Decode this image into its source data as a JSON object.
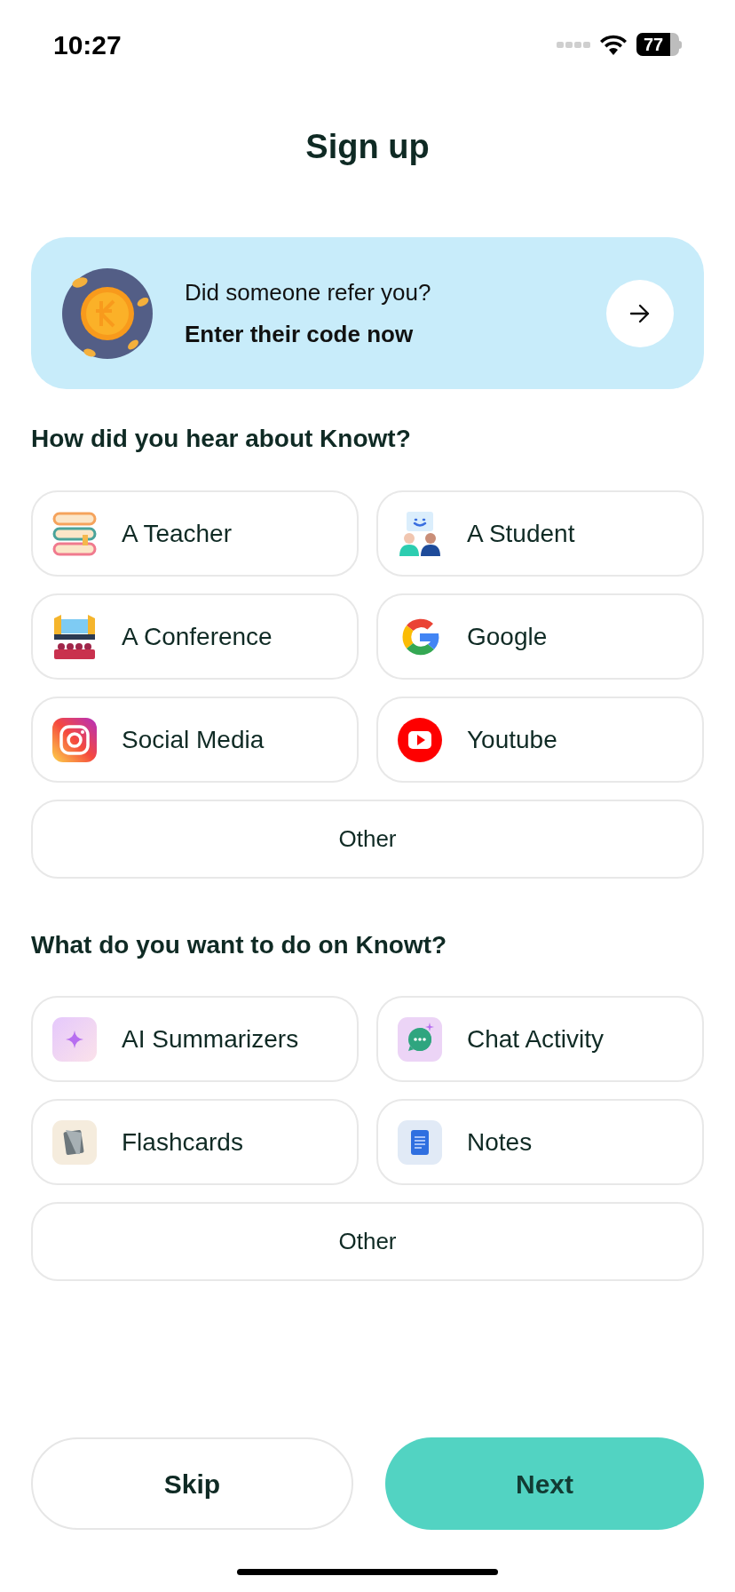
{
  "status_bar": {
    "time": "10:27",
    "battery": "77"
  },
  "title": "Sign up",
  "referral": {
    "question": "Did someone refer you?",
    "action": "Enter their code now"
  },
  "heard_about": {
    "heading": "How did you hear about Knowt?",
    "options": [
      {
        "label": "A Teacher",
        "kind": "teacher"
      },
      {
        "label": "A Student",
        "kind": "student"
      },
      {
        "label": "A Conference",
        "kind": "conference"
      },
      {
        "label": "Google",
        "kind": "google"
      },
      {
        "label": "Social Media",
        "kind": "instagram"
      },
      {
        "label": "Youtube",
        "kind": "youtube"
      },
      {
        "label": "Other",
        "kind": "plain"
      }
    ]
  },
  "goals": {
    "heading": "What do you want to do on Knowt?",
    "options": [
      {
        "label": "AI Summarizers",
        "kind": "sparkle"
      },
      {
        "label": "Chat Activity",
        "kind": "chat"
      },
      {
        "label": "Flashcards",
        "kind": "cards"
      },
      {
        "label": "Notes",
        "kind": "notes"
      },
      {
        "label": "Other",
        "kind": "plain"
      }
    ]
  },
  "buttons": {
    "skip": "Skip",
    "next": "Next"
  }
}
